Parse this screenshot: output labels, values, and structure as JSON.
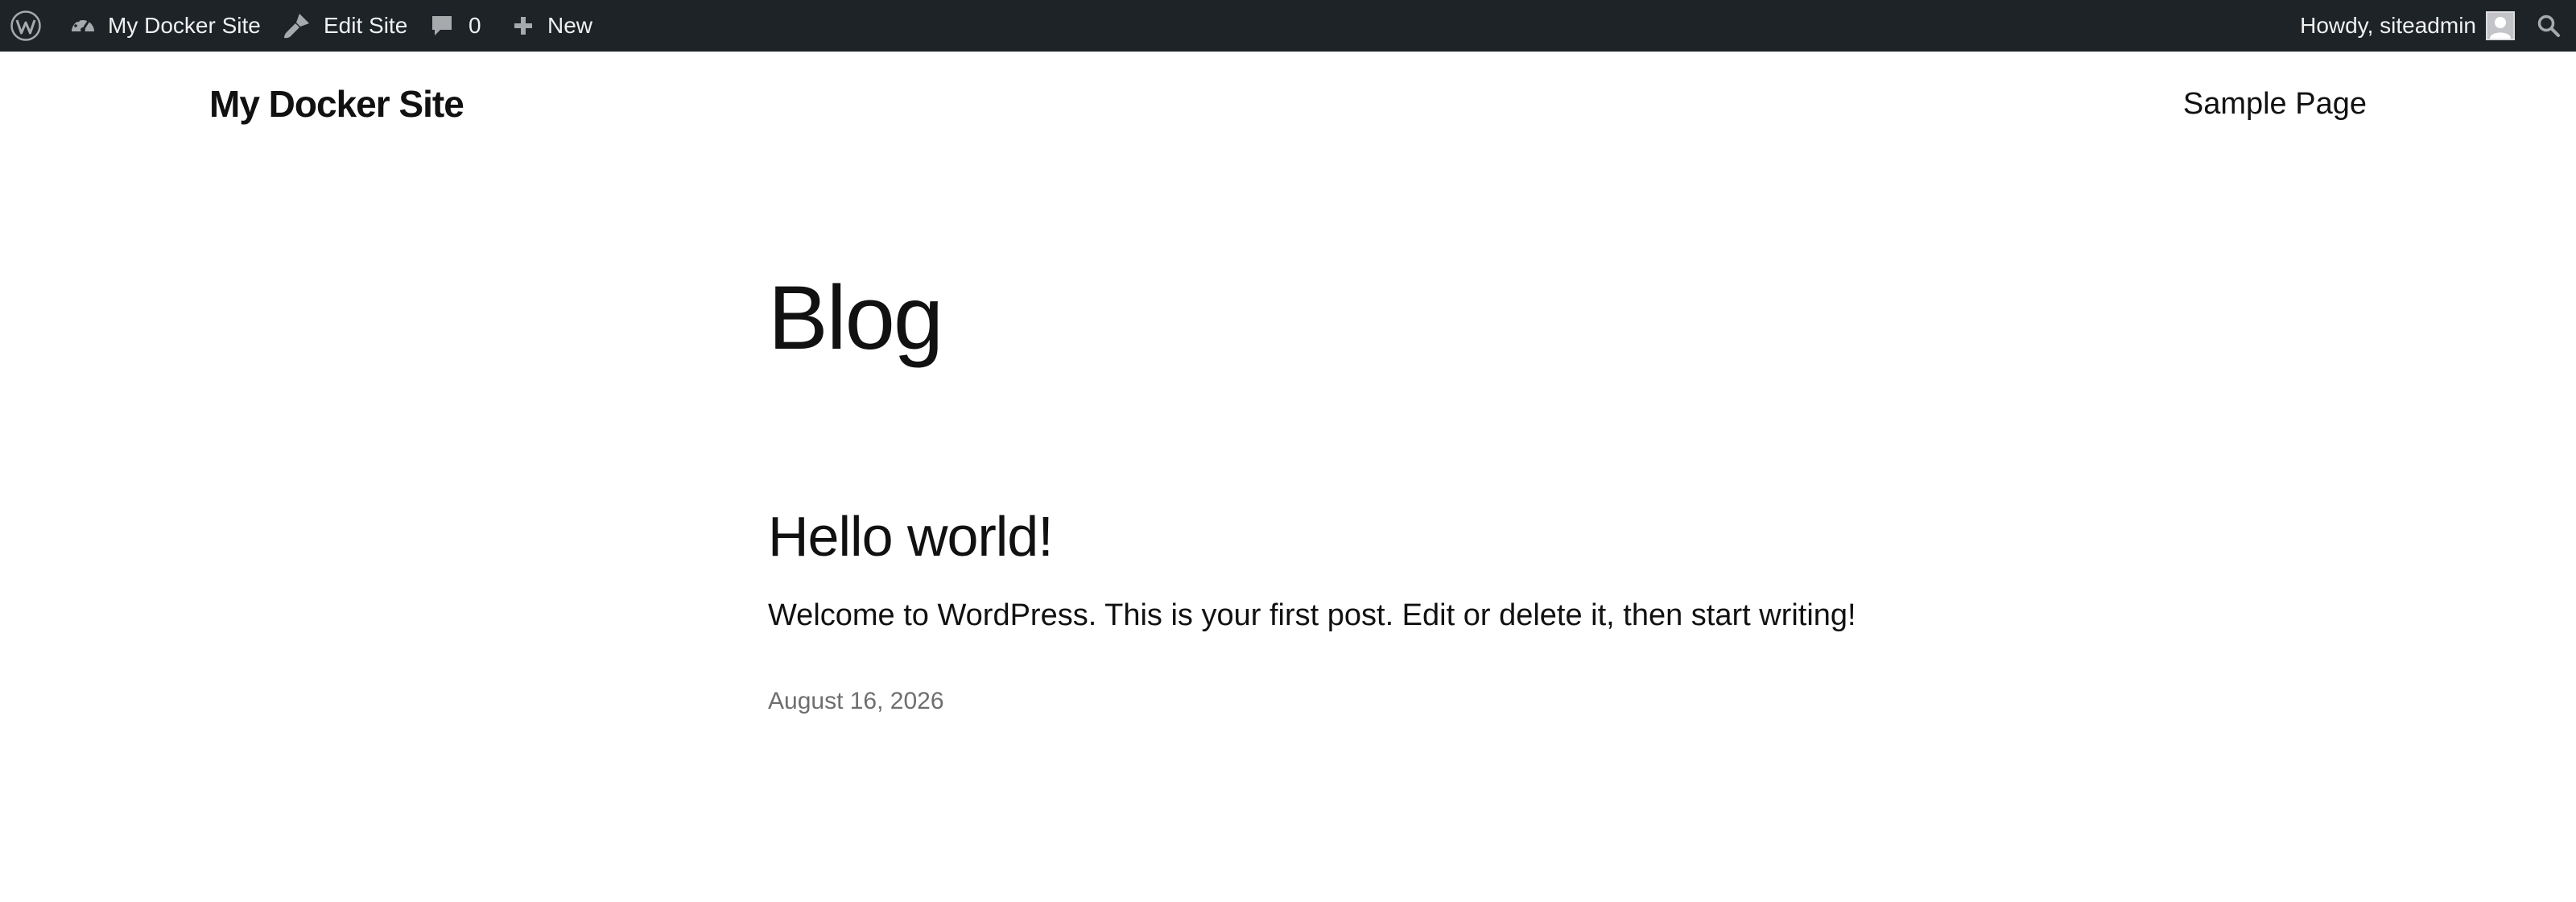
{
  "admin_bar": {
    "wp_logo_icon": "wordpress-logo-icon",
    "site_name": "My Docker Site",
    "site_icon": "dashboard-icon",
    "edit_site": "Edit Site",
    "edit_icon": "brush-icon",
    "comments_count": "0",
    "comments_icon": "comment-bubble-icon",
    "new": "New",
    "new_icon": "plus-icon",
    "greeting": "Howdy, siteadmin",
    "avatar_icon": "user-avatar-icon",
    "search_icon": "search-icon",
    "background_color": "#1d2327",
    "text_color": "#f0f0f1"
  },
  "header": {
    "site_title": "My Docker Site",
    "nav": [
      {
        "label": "Sample Page"
      }
    ]
  },
  "main": {
    "heading": "Blog",
    "posts": [
      {
        "title": "Hello world!",
        "excerpt": "Welcome to WordPress. This is your first post. Edit or delete it, then start writing!",
        "date": "August 16, 2026"
      }
    ]
  }
}
